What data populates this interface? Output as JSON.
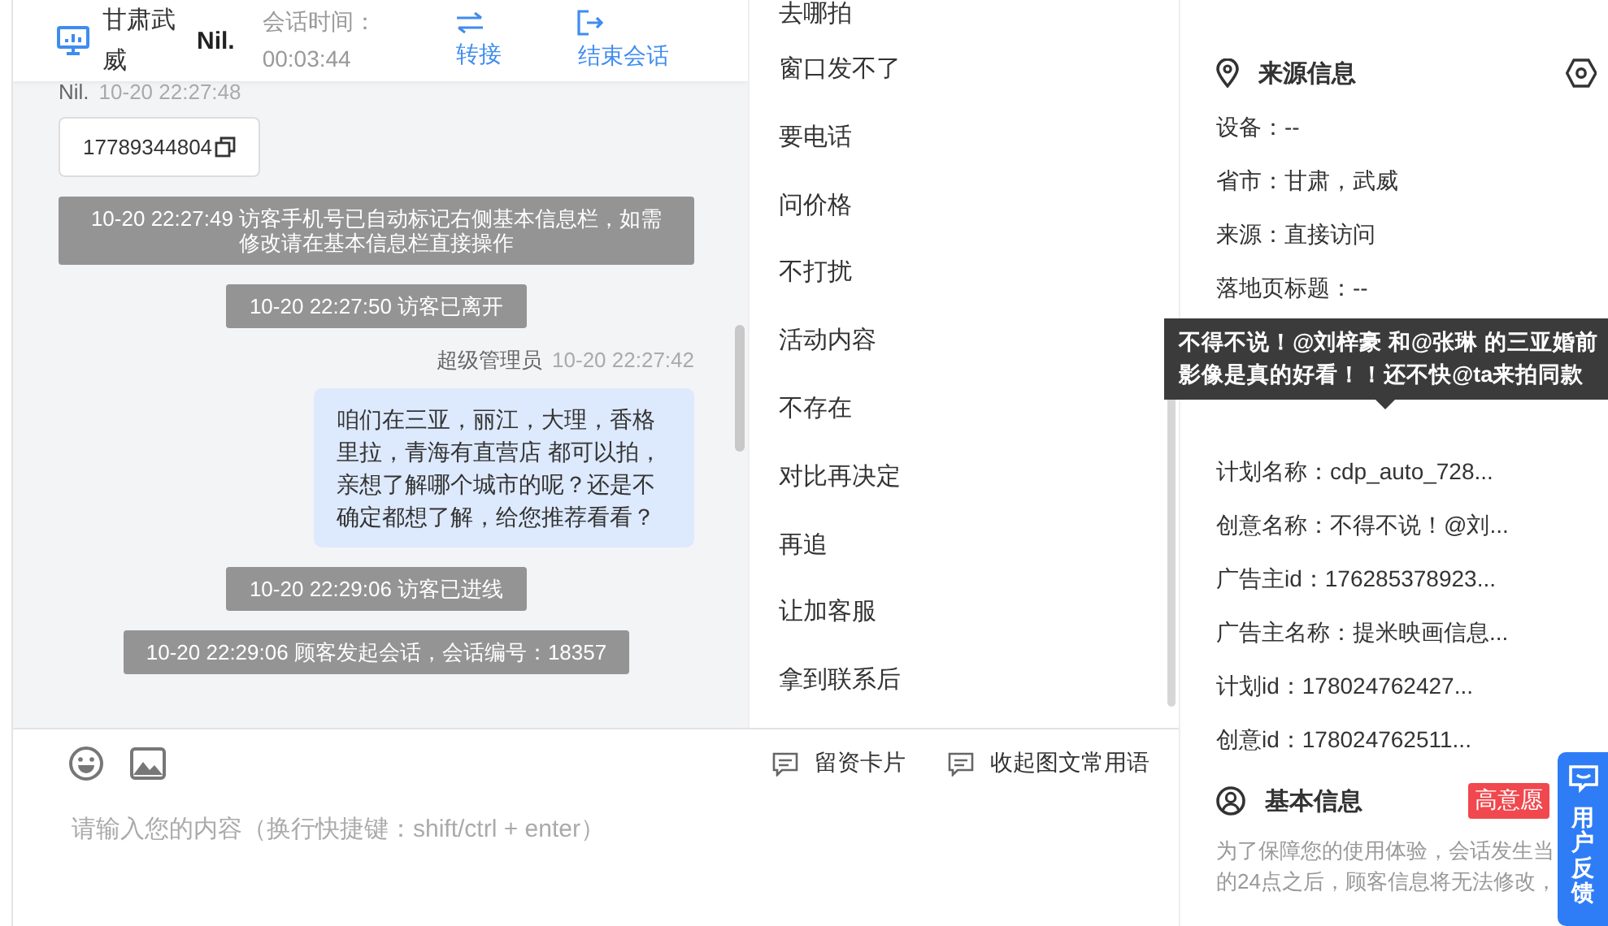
{
  "header": {
    "location": "甘肃武威",
    "visitor": "Nil.",
    "duration_label": "会话时间：",
    "duration": "00:03:44",
    "actions": [
      {
        "kind": "transfer",
        "label": "转接"
      },
      {
        "kind": "end",
        "label": "结束会话"
      }
    ]
  },
  "messages": [
    {
      "kind": "visitor",
      "sender": "Nil.",
      "time": "10-20 22:27:48",
      "text": "17789344804"
    },
    {
      "kind": "system",
      "text": "10-20 22:27:49 访客手机号已自动标记右侧基本信息栏，如需修改请在基本信息栏直接操作"
    },
    {
      "kind": "system",
      "text": "10-20 22:27:50 访客已离开"
    },
    {
      "kind": "agent",
      "sender": "超级管理员",
      "time": "10-20 22:27:42",
      "text": "咱们在三亚，丽江，大理，香格里拉，青海有直营店 都可以拍，亲想了解哪个城市的呢？还是不确定都想了解，给您推荐看看？"
    },
    {
      "kind": "system",
      "text": "10-20 22:29:06 访客已进线"
    },
    {
      "kind": "system",
      "text": "10-20 22:29:06 顾客发起会话，会话编号：18357"
    }
  ],
  "input": {
    "actions": [
      "留资卡片",
      "收起图文常用语"
    ],
    "placeholder": "请输入您的内容（换行快捷键：shift/ctrl + enter）"
  },
  "quick_replies": [
    "去哪拍",
    "窗口发不了",
    "要电话",
    "问价格",
    "不打扰",
    "活动内容",
    "不存在",
    "对比再决定",
    "再追",
    "让加客服",
    "拿到联系后"
  ],
  "source_info": {
    "title": "来源信息",
    "fields": [
      "设备：--",
      "省市：甘肃，武威",
      "来源：直接访问",
      "落地页标题：--",
      "计划名称：cdp_auto_728...",
      "创意名称：不得不说！@刘...",
      "广告主id：176285378923...",
      "广告主名称：提米映画信息...",
      "计划id：178024762427...",
      "创意id：178024762511..."
    ],
    "tooltip": "不得不说！@刘梓豪 和@张琳 的三亚婚前影像是真的好看！！还不快@ta来拍同款"
  },
  "basic_info": {
    "title": "基本信息",
    "badge": "高意愿",
    "notice_lines": [
      "为了保障您的使用体验，会话发生当",
      "的24点之后，顾客信息将无法修改，"
    ]
  },
  "feedback": "用户反馈"
}
